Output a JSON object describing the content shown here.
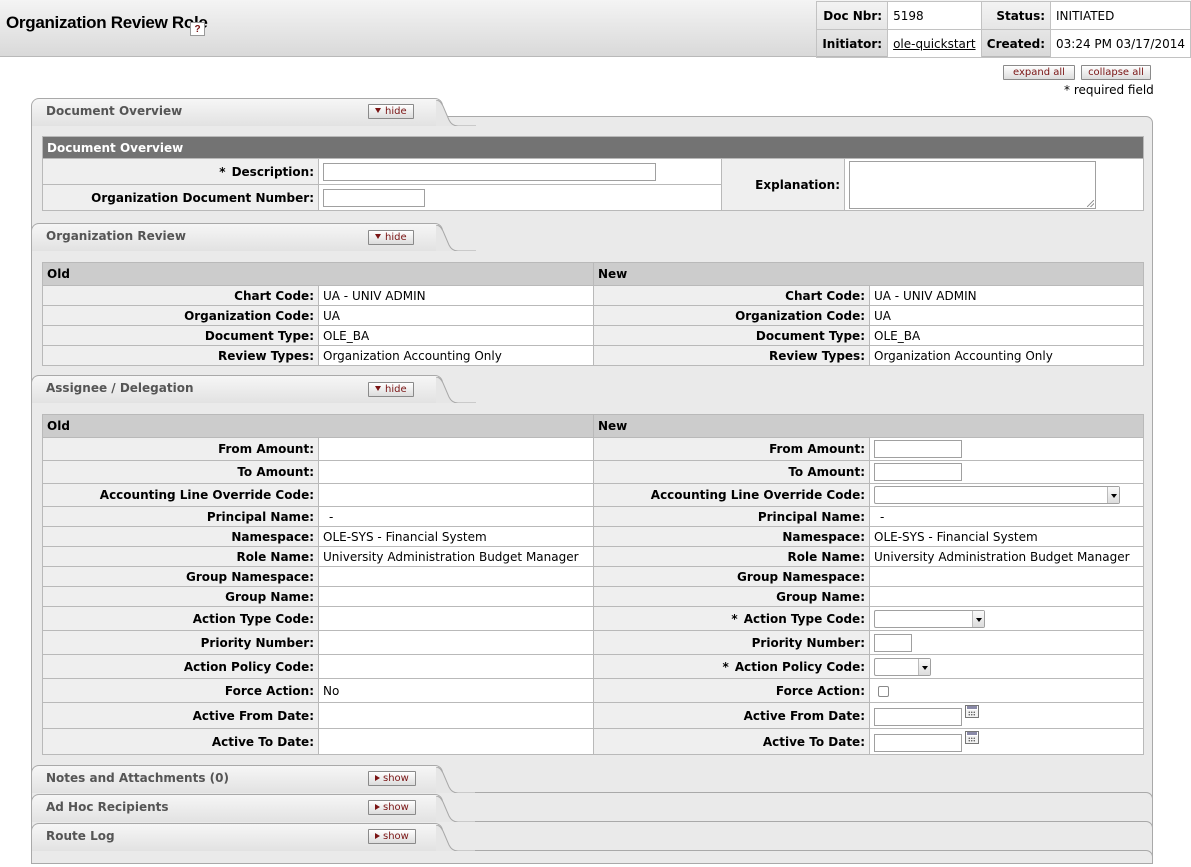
{
  "header": {
    "title": "Organization Review Role",
    "help_icon": "?",
    "doc_nbr_label": "Doc Nbr:",
    "doc_nbr": "5198",
    "status_label": "Status:",
    "status": "INITIATED",
    "initiator_label": "Initiator:",
    "initiator": "ole-quickstart",
    "created_label": "Created:",
    "created": "03:24 PM 03/17/2014"
  },
  "controls": {
    "expand_all": "expand all",
    "collapse_all": "collapse all",
    "required_note": "* required field"
  },
  "document_overview": {
    "tab_title": "Document Overview",
    "toggle": "hide",
    "header": "Document Overview",
    "required_mark": "*",
    "description_label": "Description:",
    "description_value": "",
    "org_doc_number_label": "Organization Document Number:",
    "org_doc_number_value": "",
    "explanation_label": "Explanation:",
    "explanation_value": ""
  },
  "organization_review": {
    "tab_title": "Organization Review",
    "toggle": "hide",
    "old_header": "Old",
    "new_header": "New",
    "rows": [
      {
        "label": "Chart Code:",
        "old": "UA - UNIV ADMIN",
        "new": "UA - UNIV ADMIN"
      },
      {
        "label": "Organization Code:",
        "old": "UA",
        "new": "UA"
      },
      {
        "label": "Document Type:",
        "old": "OLE_BA",
        "new": "OLE_BA"
      },
      {
        "label": "Review Types:",
        "old": "Organization Accounting Only",
        "new": "Organization Accounting Only"
      }
    ]
  },
  "assignee": {
    "tab_title": "Assignee / Delegation",
    "toggle": "hide",
    "old_header": "Old",
    "new_header": "New",
    "required_mark": "*",
    "labels": {
      "from_amount": "From Amount:",
      "to_amount": "To Amount:",
      "acct_override": "Accounting Line Override Code:",
      "principal_name": "Principal Name:",
      "namespace": "Namespace:",
      "role_name": "Role Name:",
      "group_namespace": "Group Namespace:",
      "group_name": "Group Name:",
      "action_type_code": "Action Type Code:",
      "priority_number": "Priority Number:",
      "action_policy_code": "Action Policy Code:",
      "force_action": "Force Action:",
      "active_from_date": "Active From Date:",
      "active_to_date": "Active To Date:"
    },
    "old": {
      "from_amount": "",
      "to_amount": "",
      "acct_override": "",
      "principal_name": "-",
      "namespace": "OLE-SYS - Financial System",
      "role_name": "University Administration Budget Manager",
      "group_namespace": "",
      "group_name": "",
      "action_type_code": "",
      "priority_number": "",
      "action_policy_code": "",
      "force_action": "No",
      "active_from_date": "",
      "active_to_date": ""
    },
    "new": {
      "principal_name": "-",
      "namespace": "OLE-SYS - Financial System",
      "role_name": "University Administration Budget Manager",
      "group_namespace": "",
      "group_name": ""
    }
  },
  "collapsed_tabs": [
    {
      "title": "Notes and Attachments (0)",
      "toggle": "show"
    },
    {
      "title": "Ad Hoc Recipients",
      "toggle": "show"
    },
    {
      "title": "Route Log",
      "toggle": "show"
    }
  ]
}
